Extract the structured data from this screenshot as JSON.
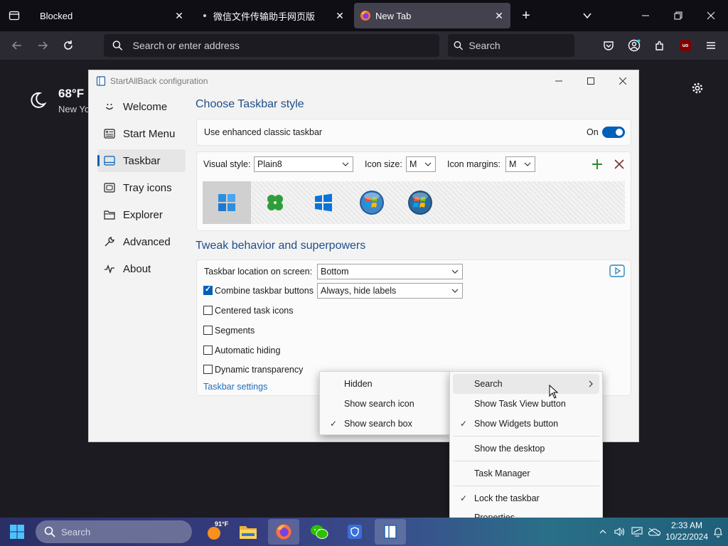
{
  "browser": {
    "tabs": [
      {
        "title": "Blocked",
        "active": false
      },
      {
        "title": "微信文件传输助手网页版",
        "active": false
      },
      {
        "title": "New Tab",
        "active": true
      }
    ],
    "urlbar_placeholder": "Search or enter address",
    "searchbar_placeholder": "Search",
    "addon_badge": "uo"
  },
  "weather": {
    "temperature": "68°F",
    "city": "New Yo"
  },
  "dialog": {
    "title": "StartAllBack configuration",
    "nav": [
      {
        "label": "Welcome",
        "icon": "smiley-icon"
      },
      {
        "label": "Start Menu",
        "icon": "start-menu-icon"
      },
      {
        "label": "Taskbar",
        "icon": "taskbar-icon",
        "active": true
      },
      {
        "label": "Tray icons",
        "icon": "tray-icon"
      },
      {
        "label": "Explorer",
        "icon": "folder-icon"
      },
      {
        "label": "Advanced",
        "icon": "wrench-icon"
      },
      {
        "label": "About",
        "icon": "about-icon"
      }
    ],
    "section1_title": "Choose Taskbar style",
    "enhanced_label": "Use enhanced classic taskbar",
    "enhanced_state": "On",
    "visual_style_label": "Visual style:",
    "visual_style_value": "Plain8",
    "icon_size_label": "Icon size:",
    "icon_size_value": "M",
    "icon_margins_label": "Icon margins:",
    "icon_margins_value": "M",
    "styles": [
      "windows11-style",
      "clover-style",
      "windows10-style",
      "windows7-orb-style",
      "vista-orb-style"
    ],
    "section2_title": "Tweak behavior and superpowers",
    "location_label": "Taskbar location on screen:",
    "location_value": "Bottom",
    "combine_label": "Combine taskbar buttons",
    "combine_value": "Always, hide labels",
    "options": [
      {
        "label": "Centered task icons",
        "checked": false
      },
      {
        "label": "Segments",
        "checked": false
      },
      {
        "label": "Automatic hiding",
        "checked": false
      },
      {
        "label": "Dynamic transparency",
        "checked": false
      }
    ],
    "combine_checked": true,
    "settings_link": "Taskbar settings"
  },
  "context_menu": {
    "items": [
      {
        "label": "Search",
        "submenu": true,
        "highlighted": true,
        "checked": false
      },
      {
        "label": "Show Task View button",
        "checked": false
      },
      {
        "label": "Show Widgets button",
        "checked": true
      },
      {
        "label": "Show the desktop",
        "checked": false
      },
      {
        "label": "Task Manager",
        "checked": false
      },
      {
        "label": "Lock the taskbar",
        "checked": true
      },
      {
        "label": "Properties",
        "checked": false
      }
    ]
  },
  "search_submenu": {
    "items": [
      {
        "label": "Hidden",
        "checked": false
      },
      {
        "label": "Show search icon",
        "checked": false
      },
      {
        "label": "Show search box",
        "checked": true
      }
    ]
  },
  "taskbar": {
    "search_placeholder": "Search",
    "weather_badge": "91°F",
    "time": "2:33 AM",
    "date": "10/22/2024"
  },
  "colors": {
    "accent": "#005fb8",
    "section_title": "#1f4e8a",
    "browser_bg": "#1c1b22"
  }
}
